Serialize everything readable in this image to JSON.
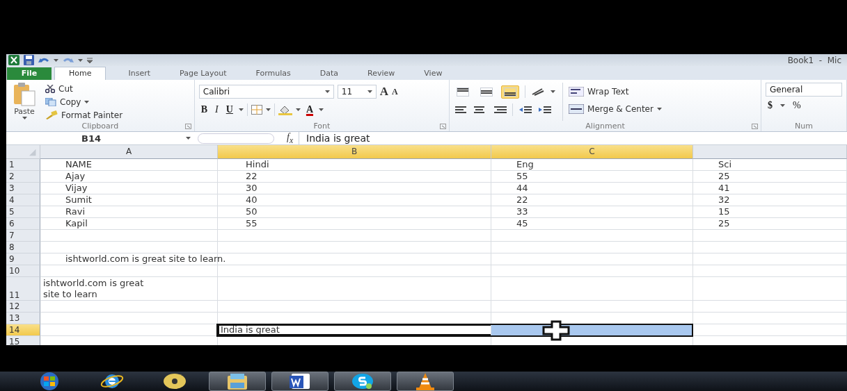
{
  "title_bar": {
    "title": "Book1  -  Mic"
  },
  "tabs": [
    {
      "label": "File",
      "kind": "file",
      "selected": false
    },
    {
      "label": "Home",
      "kind": "tab",
      "selected": true
    },
    {
      "label": "Insert",
      "kind": "tab",
      "selected": false
    },
    {
      "label": "Page Layout",
      "kind": "tab",
      "selected": false
    },
    {
      "label": "Formulas",
      "kind": "tab",
      "selected": false
    },
    {
      "label": "Data",
      "kind": "tab",
      "selected": false
    },
    {
      "label": "Review",
      "kind": "tab",
      "selected": false
    },
    {
      "label": "View",
      "kind": "tab",
      "selected": false
    }
  ],
  "ribbon": {
    "clipboard": {
      "paste": "Paste",
      "cut": "Cut",
      "copy": "Copy",
      "format_painter": "Format Painter",
      "label": "Clipboard"
    },
    "font": {
      "name": "Calibri",
      "size": "11",
      "grow": "A",
      "shrink": "A",
      "bold": "B",
      "italic": "I",
      "underline": "U",
      "font_color": "A",
      "label": "Font"
    },
    "alignment": {
      "buttons": [
        {
          "kind": "top",
          "selected": false
        },
        {
          "kind": "middle",
          "selected": false
        },
        {
          "kind": "bottom",
          "selected": true
        }
      ],
      "wrap_text": "Wrap Text",
      "merge": "Merge & Center",
      "label": "Alignment"
    },
    "number": {
      "format": "General",
      "currency": "$",
      "percent": "%",
      "label": "Num"
    }
  },
  "formula_bar": {
    "name_box": "B14",
    "fx": "f$_{x}$",
    "value": "India is great"
  },
  "grid": {
    "columns": [
      {
        "label": "A",
        "selected": false
      },
      {
        "label": "B",
        "selected": true
      },
      {
        "label": "C",
        "selected": true
      },
      {
        "selected": false
      }
    ],
    "rows": [
      {
        "number": "1",
        "selected": false,
        "indent": true,
        "cells": [
          {
            "text": "NAME",
            "selected": false
          },
          {
            "text": "Hindi",
            "selected": false
          },
          {
            "text": "Eng",
            "selected": false
          },
          {
            "text": "Sci",
            "selected": false
          }
        ]
      },
      {
        "number": "2",
        "selected": false,
        "indent": true,
        "cells": [
          {
            "text": "Ajay",
            "selected": false
          },
          {
            "text": "22",
            "selected": false
          },
          {
            "text": "55",
            "selected": false
          },
          {
            "text": "25",
            "selected": false
          }
        ]
      },
      {
        "number": "3",
        "selected": false,
        "indent": true,
        "cells": [
          {
            "text": "Vijay",
            "selected": false
          },
          {
            "text": "30",
            "selected": false
          },
          {
            "text": "44",
            "selected": false
          },
          {
            "text": "41",
            "selected": false
          }
        ]
      },
      {
        "number": "4",
        "selected": false,
        "indent": true,
        "cells": [
          {
            "text": "Sumit",
            "selected": false
          },
          {
            "text": "40",
            "selected": false
          },
          {
            "text": "22",
            "selected": false
          },
          {
            "text": "32",
            "selected": false
          }
        ]
      },
      {
        "number": "5",
        "selected": false,
        "indent": true,
        "cells": [
          {
            "text": "Ravi",
            "selected": false
          },
          {
            "text": "50",
            "selected": false
          },
          {
            "text": "33",
            "selected": false
          },
          {
            "text": "15",
            "selected": false
          }
        ]
      },
      {
        "number": "6",
        "selected": false,
        "indent": true,
        "cells": [
          {
            "text": "Kapil",
            "selected": false
          },
          {
            "text": "55",
            "selected": false
          },
          {
            "text": "45",
            "selected": false
          },
          {
            "text": "25",
            "selected": false
          }
        ]
      },
      {
        "number": "7",
        "selected": false,
        "cells": [
          {
            "selected": false
          },
          {
            "selected": false
          },
          {
            "selected": false
          },
          {
            "selected": false
          }
        ]
      },
      {
        "number": "8",
        "selected": false,
        "cells": [
          {
            "selected": false
          },
          {
            "selected": false
          },
          {
            "selected": false
          },
          {
            "selected": false
          }
        ]
      },
      {
        "number": "9",
        "selected": false,
        "indent": true,
        "cells": [
          {
            "text": "ishtworld.com is great site to learn.",
            "selected": false
          },
          {
            "selected": false
          },
          {
            "selected": false
          },
          {
            "selected": false
          }
        ]
      },
      {
        "number": "10",
        "selected": false,
        "cells": [
          {
            "selected": false
          },
          {
            "selected": false
          },
          {
            "selected": false
          },
          {
            "selected": false
          }
        ]
      },
      {
        "number": "11",
        "selected": false,
        "indent": false,
        "cells": [
          {
            "lines": [
              "ishtworld.com is great",
              "site to learn"
            ],
            "selected": false
          },
          {
            "selected": false
          },
          {
            "selected": false
          },
          {
            "selected": false
          }
        ]
      },
      {
        "number": "12",
        "selected": false,
        "cells": [
          {
            "selected": false
          },
          {
            "selected": false
          },
          {
            "selected": false
          },
          {
            "selected": false
          }
        ]
      },
      {
        "number": "13",
        "selected": false,
        "cells": [
          {
            "selected": false
          },
          {
            "selected": false
          },
          {
            "selected": false
          },
          {
            "selected": false
          }
        ]
      },
      {
        "number": "14",
        "selected": true,
        "indent": false,
        "cells": [
          {
            "selected": false
          },
          {
            "text": "India is great",
            "selected": true
          },
          {
            "selected": true
          },
          {
            "selected": false
          }
        ]
      },
      {
        "number": "15",
        "selected": false,
        "cells": [
          {
            "selected": false
          },
          {
            "selected": false
          },
          {
            "selected": false
          },
          {
            "selected": false
          }
        ]
      }
    ]
  },
  "taskbar": [
    {
      "kind": "start",
      "running": false
    },
    {
      "kind": "browser",
      "running": false
    },
    {
      "kind": "media",
      "running": false
    },
    {
      "kind": "folder",
      "running": true
    },
    {
      "kind": "word",
      "running": true
    },
    {
      "kind": "chat",
      "running": true
    },
    {
      "kind": "cone",
      "running": true
    }
  ]
}
